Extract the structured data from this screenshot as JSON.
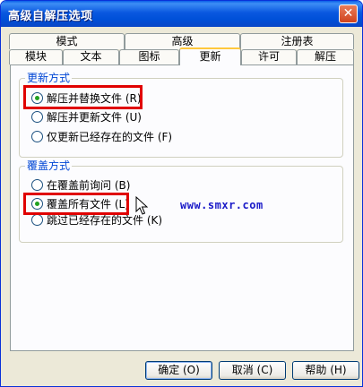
{
  "window": {
    "title": "高级自解压选项",
    "close_label": "✕"
  },
  "tabs_row1": [
    "模式",
    "高级",
    "注册表"
  ],
  "tabs_row2": [
    "模块",
    "文本",
    "图标",
    "更新",
    "许可",
    "解压"
  ],
  "update_group": {
    "legend": "更新方式",
    "options": [
      "解压并替换文件 (R)",
      "解压并更新文件 (U)",
      "仅更新已经存在的文件 (F)"
    ],
    "selected": 0
  },
  "overwrite_group": {
    "legend": "覆盖方式",
    "options": [
      "在覆盖前询问 (B)",
      "覆盖所有文件 (L)",
      "跳过已经存在的文件 (K)"
    ],
    "selected": 1
  },
  "watermark": "www.smxr.com",
  "buttons": {
    "ok": "确定 (O)",
    "cancel": "取消 (C)",
    "help": "帮助 (H)"
  }
}
